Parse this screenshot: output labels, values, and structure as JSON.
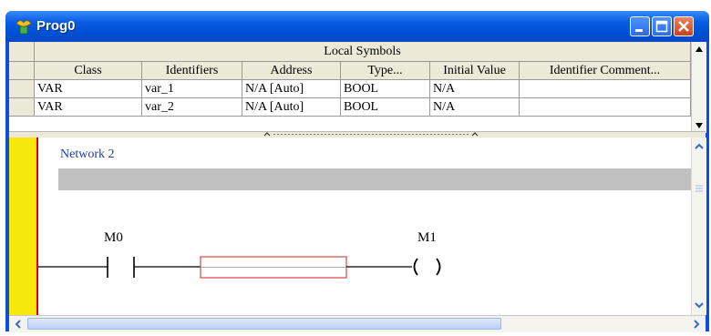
{
  "window": {
    "title": "Prog0",
    "buttons": {
      "minimize": "minimize",
      "maximize": "maximize",
      "close": "close"
    }
  },
  "symbols": {
    "caption": "Local Symbols",
    "columns": [
      "Class",
      "Identifiers",
      "Address",
      "Type...",
      "Initial Value",
      "Identifier Comment..."
    ],
    "rows": [
      {
        "class": "VAR",
        "identifier": "var_1",
        "address": "N/A [Auto]",
        "type": "BOOL",
        "initial": "N/A",
        "comment": ""
      },
      {
        "class": "VAR",
        "identifier": "var_2",
        "address": "N/A [Auto]",
        "type": "BOOL",
        "initial": "N/A",
        "comment": ""
      }
    ]
  },
  "ladder": {
    "network_label": "Network 2",
    "contact_label": "M0",
    "coil_label": "M1",
    "colors": {
      "gutter": "#f6e70c",
      "power_rail": "#e00000",
      "network_label": "#1a3ab0",
      "placeholder_box": "#cc2222"
    }
  }
}
